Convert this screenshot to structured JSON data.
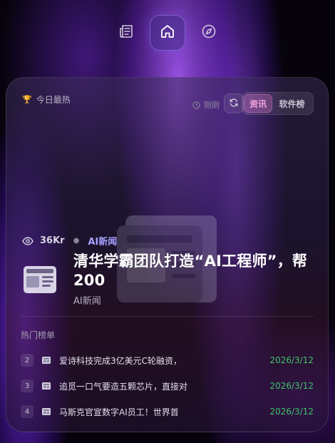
{
  "nav": {
    "items": [
      {
        "name": "news",
        "icon": "newspaper-icon",
        "active": false
      },
      {
        "name": "home",
        "icon": "home-icon",
        "active": true
      },
      {
        "name": "explore",
        "icon": "compass-icon",
        "active": false
      }
    ]
  },
  "card": {
    "title": "今日最热",
    "title_icon": "trophy-icon",
    "updated_label": "刚刚",
    "tabs": [
      {
        "label": "资讯",
        "active": true
      },
      {
        "label": "软件榜",
        "active": false
      }
    ],
    "featured": {
      "views": "36Kr",
      "category": "AI新闻",
      "headline": "清华学霸团队打造“AI工程师”，帮200",
      "subtitle": "AI新闻"
    },
    "list_title": "热门榜单",
    "list": [
      {
        "rank": "2",
        "title": "爱诗科技完成3亿美元C轮融资，",
        "date": "2026/3/12"
      },
      {
        "rank": "3",
        "title": "追觅一口气要造五颗芯片，直接对",
        "date": "2026/3/12"
      },
      {
        "rank": "4",
        "title": "马斯克官宣数字AI员工！世界首",
        "date": "2026/3/12"
      }
    ]
  },
  "colors": {
    "accent_pink": "#f2a6e0",
    "category_violet": "#a9a2ff",
    "date_green": "#3fc46a"
  }
}
